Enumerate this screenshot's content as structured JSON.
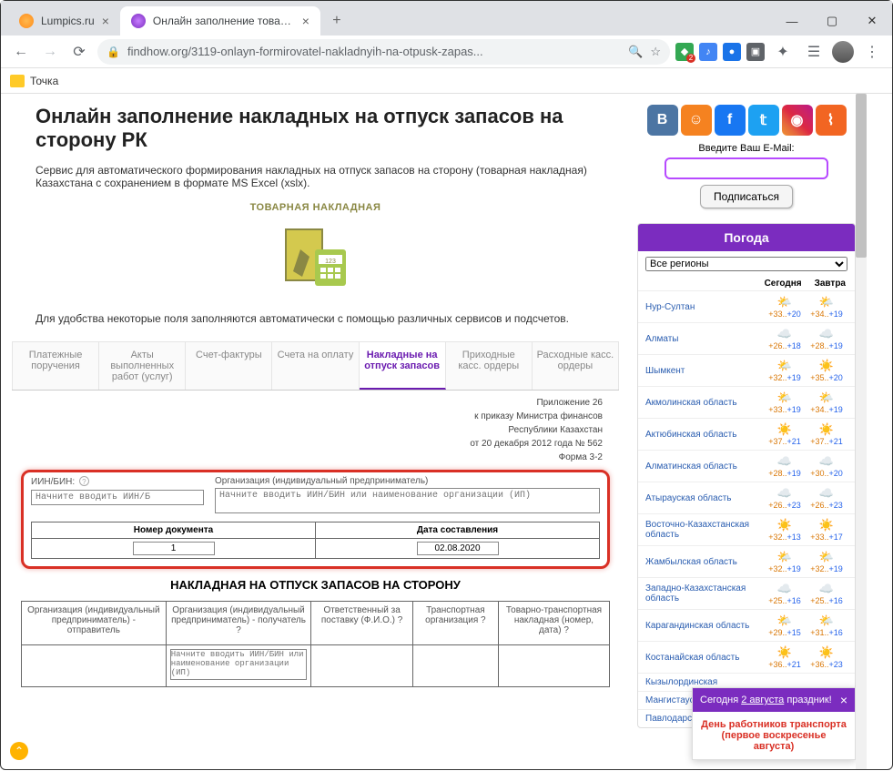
{
  "browser": {
    "tabs": [
      {
        "title": "Lumpics.ru",
        "active": false
      },
      {
        "title": "Онлайн заполнение товарной н",
        "active": true
      }
    ],
    "url": "findhow.org/3119-onlayn-formirovatel-nakladnyih-na-otpusk-zapas...",
    "bookmark": "Точка",
    "ext_badge": "2"
  },
  "page": {
    "title": "Онлайн заполнение накладных на отпуск запасов на сторону РК",
    "intro": "Сервис для автоматического формирования накладных на отпуск запасов на сторону (товарная накладная) Казахстана с сохранением в формате MS Excel (xslx).",
    "illust_label": "ТОВАРНАЯ НАКЛАДНАЯ",
    "hint": "Для удобства некоторые поля заполняются автоматически с помощью различных сервисов и подсчетов.",
    "svc_tabs": [
      "Платежные поручения",
      "Акты выполненных работ (услуг)",
      "Счет-фактуры",
      "Счета на оплату",
      "Накладные на отпуск запасов",
      "Приходные касс. ордеры",
      "Расходные касс. ордеры"
    ],
    "form_meta": [
      "Приложение 26",
      "к приказу Министра финансов",
      "Республики Казахстан",
      "от 20 декабря 2012 года № 562",
      "Форма 3-2"
    ],
    "label_iin": "ИИН/БИН:",
    "placeholder_iin": "Начните вводить ИИН/Б",
    "label_org": "Организация (индивидуальный предприниматель)",
    "placeholder_org": "Начните вводить ИИН/БИН или наименование организации (ИП)",
    "th_docnum": "Номер документа",
    "th_docdate": "Дата составления",
    "val_docnum": "1",
    "val_docdate": "02.08.2020",
    "form_title": "НАКЛАДНАЯ НА ОТПУСК ЗАПАСОВ НА СТОРОНУ",
    "main_headers": [
      "Организация (индивидуальный предприниматель) - отправитель",
      "Организация (индивидуальный предприниматель) - получатель",
      "Ответственный за поставку (Ф.И.О.)",
      "Транспортная организация",
      "Товарно-транспортная накладная (номер, дата)"
    ],
    "placeholder_recip": "Начните вводить ИИН/БИН или наименование организации (ИП)"
  },
  "sidebar": {
    "email_label": "Введите Ваш E-Mail:",
    "subscribe": "Подписаться",
    "weather_title": "Погода",
    "region_default": "Все регионы",
    "col_today": "Сегодня",
    "col_tomorrow": "Завтра",
    "cities": [
      {
        "name": "Нур-Султан",
        "t1h": "+33..",
        "t1l": "+20",
        "t2h": "+34..",
        "t2l": "+19",
        "i1": "🌤️",
        "i2": "🌤️"
      },
      {
        "name": "Алматы",
        "t1h": "+26..",
        "t1l": "+18",
        "t2h": "+28..",
        "t2l": "+19",
        "i1": "☁️",
        "i2": "☁️"
      },
      {
        "name": "Шымкент",
        "t1h": "+32..",
        "t1l": "+19",
        "t2h": "+35..",
        "t2l": "+20",
        "i1": "🌤️",
        "i2": "☀️"
      },
      {
        "name": "Акмолинская область",
        "t1h": "+33..",
        "t1l": "+19",
        "t2h": "+34..",
        "t2l": "+19",
        "i1": "🌤️",
        "i2": "🌤️"
      },
      {
        "name": "Актюбинская область",
        "t1h": "+37..",
        "t1l": "+21",
        "t2h": "+37..",
        "t2l": "+21",
        "i1": "☀️",
        "i2": "☀️"
      },
      {
        "name": "Алматинская область",
        "t1h": "+28..",
        "t1l": "+19",
        "t2h": "+30..",
        "t2l": "+20",
        "i1": "☁️",
        "i2": "☁️"
      },
      {
        "name": "Атырауская область",
        "t1h": "+26..",
        "t1l": "+23",
        "t2h": "+26..",
        "t2l": "+23",
        "i1": "☁️",
        "i2": "☁️"
      },
      {
        "name": "Восточно-Казахстанская область",
        "t1h": "+32..",
        "t1l": "+13",
        "t2h": "+33..",
        "t2l": "+17",
        "i1": "☀️",
        "i2": "☀️"
      },
      {
        "name": "Жамбылская область",
        "t1h": "+32..",
        "t1l": "+19",
        "t2h": "+32..",
        "t2l": "+19",
        "i1": "🌤️",
        "i2": "🌤️"
      },
      {
        "name": "Западно-Казахстанская область",
        "t1h": "+25..",
        "t1l": "+16",
        "t2h": "+25..",
        "t2l": "+16",
        "i1": "☁️",
        "i2": "☁️"
      },
      {
        "name": "Карагандинская область",
        "t1h": "+29..",
        "t1l": "+15",
        "t2h": "+31..",
        "t2l": "+16",
        "i1": "🌤️",
        "i2": "🌤️"
      },
      {
        "name": "Костанайская область",
        "t1h": "+36..",
        "t1l": "+21",
        "t2h": "+36..",
        "t2l": "+23",
        "i1": "☀️",
        "i2": "☀️"
      },
      {
        "name": "Кызылординская",
        "t1h": "",
        "t1l": "",
        "t2h": "",
        "t2l": "",
        "i1": "",
        "i2": ""
      },
      {
        "name": "Мангистауская о",
        "t1h": "",
        "t1l": "",
        "t2h": "",
        "t2l": "",
        "i1": "",
        "i2": ""
      },
      {
        "name": "Павлодарская о",
        "t1h": "",
        "t1l": "",
        "t2h": "",
        "t2l": "",
        "i1": "",
        "i2": ""
      }
    ]
  },
  "holiday": {
    "header_pre": "Сегодня ",
    "header_date": "2 августа",
    "header_post": " праздник!",
    "body": "День работников транспорта (первое воскресенье августа)"
  }
}
